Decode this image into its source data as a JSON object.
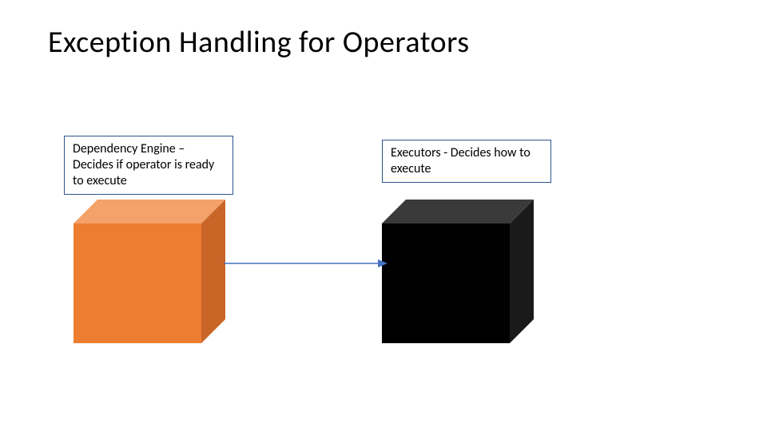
{
  "title": "Exception Handling for Operators",
  "boxes": {
    "left": "Dependency Engine – Decides if operator is ready to execute",
    "right": "Executors - Decides how to execute"
  },
  "cubes": {
    "left": {
      "color": "orange",
      "semantic": "dependency-engine-cube"
    },
    "right": {
      "color": "black",
      "semantic": "executors-cube"
    }
  },
  "arrow": {
    "color": "#4472c4",
    "semantic": "flow-arrow"
  }
}
